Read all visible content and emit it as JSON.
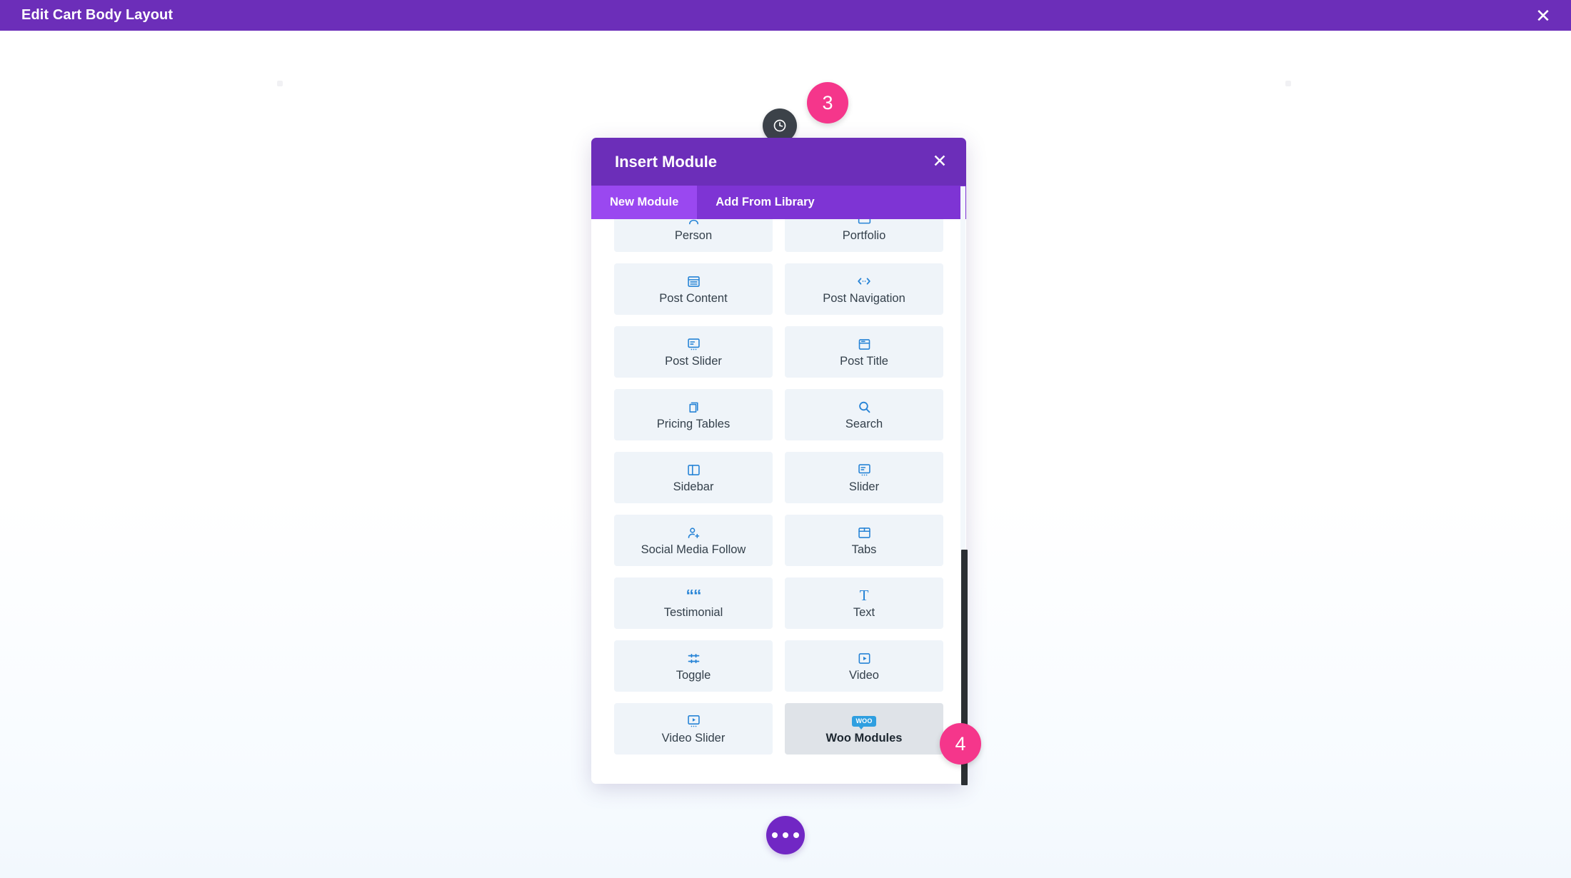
{
  "topbar": {
    "title": "Edit Cart Body Layout",
    "close_icon": "close-icon",
    "close_label": "✕",
    "bg_color": "#6c2eb9"
  },
  "modal": {
    "title": "Insert Module",
    "close_label": "✕",
    "header_color": "#6c2eb9",
    "tabs": [
      {
        "label": "New Module",
        "active": true
      },
      {
        "label": "Add From Library",
        "active": false
      }
    ],
    "modules": [
      {
        "label": "Person",
        "icon": "person-icon",
        "highlight": false,
        "clipped": true
      },
      {
        "label": "Portfolio",
        "icon": "portfolio-icon",
        "highlight": false,
        "clipped": true
      },
      {
        "label": "Post Content",
        "icon": "post-content-icon",
        "highlight": false
      },
      {
        "label": "Post Navigation",
        "icon": "post-navigation-icon",
        "highlight": false
      },
      {
        "label": "Post Slider",
        "icon": "post-slider-icon",
        "highlight": false
      },
      {
        "label": "Post Title",
        "icon": "post-title-icon",
        "highlight": false
      },
      {
        "label": "Pricing Tables",
        "icon": "pricing-tables-icon",
        "highlight": false
      },
      {
        "label": "Search",
        "icon": "search-icon",
        "highlight": false
      },
      {
        "label": "Sidebar",
        "icon": "sidebar-icon",
        "highlight": false
      },
      {
        "label": "Slider",
        "icon": "slider-icon",
        "highlight": false
      },
      {
        "label": "Social Media Follow",
        "icon": "social-follow-icon",
        "highlight": false
      },
      {
        "label": "Tabs",
        "icon": "tabs-icon",
        "highlight": false
      },
      {
        "label": "Testimonial",
        "icon": "testimonial-icon",
        "highlight": false
      },
      {
        "label": "Text",
        "icon": "text-icon",
        "highlight": false
      },
      {
        "label": "Toggle",
        "icon": "toggle-icon",
        "highlight": false
      },
      {
        "label": "Video",
        "icon": "video-icon",
        "highlight": false
      },
      {
        "label": "Video Slider",
        "icon": "video-slider-icon",
        "highlight": false
      },
      {
        "label": "Woo Modules",
        "icon": "woo-icon",
        "highlight": true,
        "icon_text": "WOO"
      }
    ],
    "accent_icon_color": "#2683d6",
    "tile_color": "#eff4f9",
    "tile_highlight_color": "#dfe3e8"
  },
  "scrollbar": {
    "thumb_color": "#2b2f33"
  },
  "badges": [
    {
      "id": "3",
      "label": "3",
      "color": "#f5368b"
    },
    {
      "id": "4",
      "label": "4",
      "color": "#f5368b"
    }
  ],
  "canvas": {
    "more_button_label": "more-options",
    "more_button_color": "#7127c4",
    "history_bubble_color": "#3c4249"
  }
}
